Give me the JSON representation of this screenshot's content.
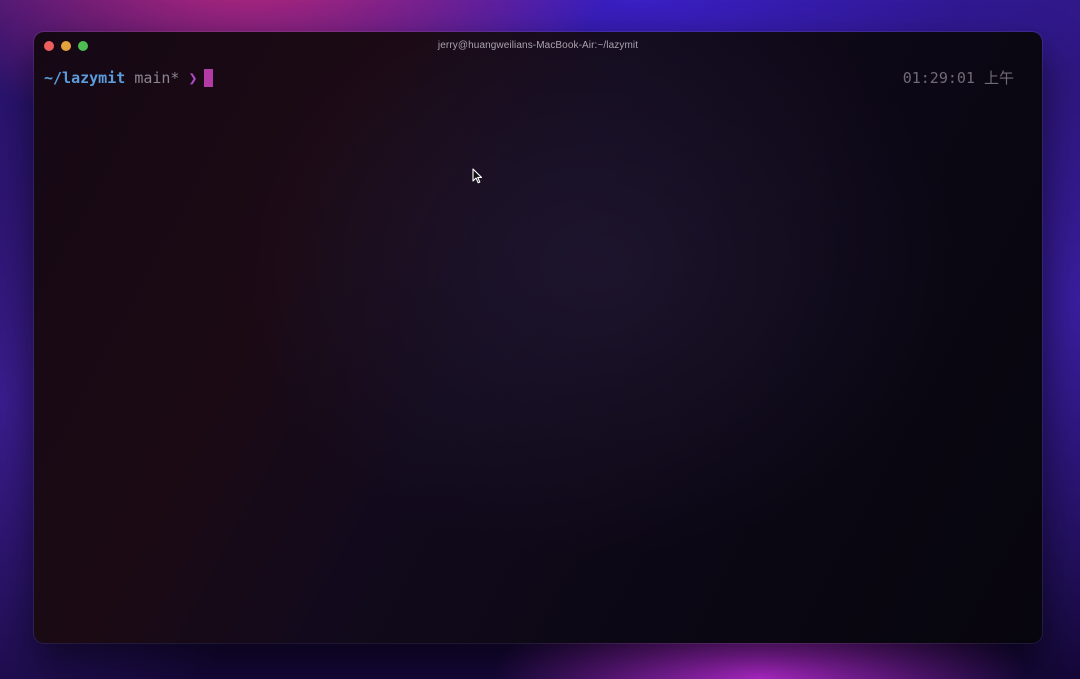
{
  "window": {
    "title": "jerry@huangweilians-MacBook-Air:~/lazymit",
    "controls": [
      {
        "name": "close",
        "color": "#ec5f5d"
      },
      {
        "name": "minimize",
        "color": "#e3a23b"
      },
      {
        "name": "zoom",
        "color": "#4cbe53"
      }
    ]
  },
  "terminal": {
    "prompt": {
      "cwd": "~/lazymit",
      "branch": "main*",
      "symbol": "❯"
    },
    "clock": "01:29:01 上午"
  },
  "colors": {
    "cwd": "#5b9cdc",
    "branch": "#8a8590",
    "symbol": "#b04cc8",
    "cursor": "#b43aa8",
    "clock": "#6f6a75"
  },
  "icons": {
    "pointer": "mouse-pointer-icon"
  }
}
